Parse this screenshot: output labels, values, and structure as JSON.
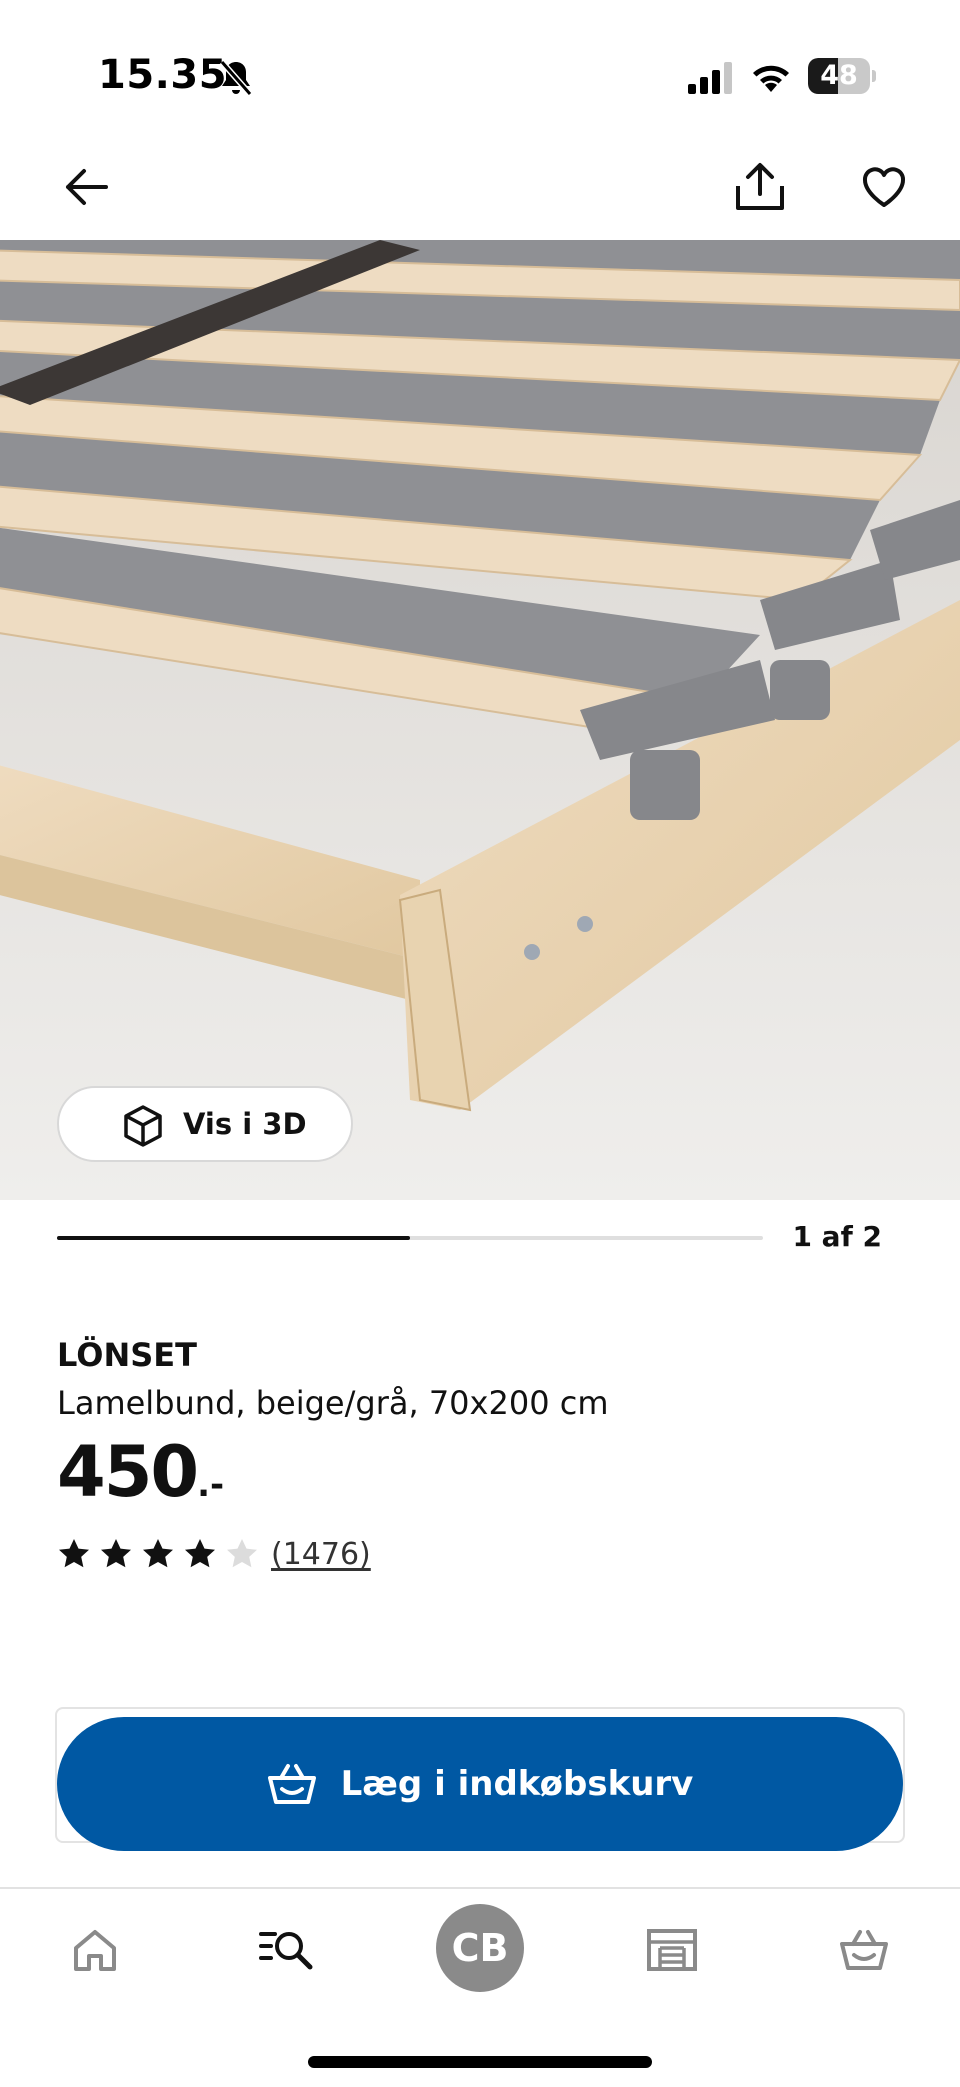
{
  "status_bar": {
    "time": "15.35",
    "battery_level": "48",
    "battery_fraction": 0.48
  },
  "header": {
    "back_icon": "arrow-left-icon",
    "share_icon": "share-icon",
    "favorite_icon": "heart-icon"
  },
  "gallery": {
    "view_3d_label": "Vis i 3D",
    "counter": "1 af 2",
    "current_index": 1,
    "total": 2
  },
  "product": {
    "name": "LÖNSET",
    "description": "Lamelbund, beige/grå, 70x200 cm",
    "price": "450",
    "price_suffix": ".-",
    "rating": 4,
    "rating_max": 5,
    "review_count": "(1476)"
  },
  "actions": {
    "add_to_cart_label": "Læg i indkøbskurv"
  },
  "bottom_nav": {
    "profile_initials": "CB",
    "items": [
      "home-icon",
      "search-list-icon",
      "avatar",
      "store-icon",
      "basket-icon"
    ]
  },
  "colors": {
    "accent": "#0058a3",
    "avatar_bg": "#8a8a8a",
    "text": "#111111"
  }
}
